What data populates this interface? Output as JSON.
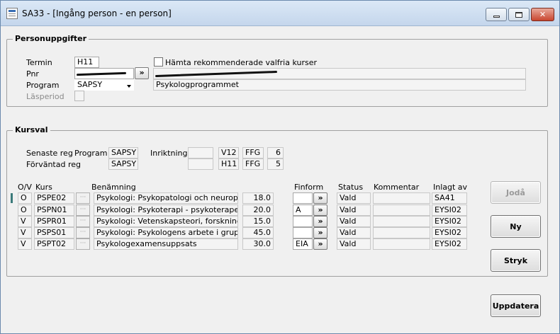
{
  "window": {
    "title": "SA33 - [Ingång person - en person]"
  },
  "personuppgifter": {
    "group_label": "Personuppgifter",
    "termin_label": "Termin",
    "termin_value": "H11",
    "pnr_label": "Pnr",
    "program_label": "Program",
    "program_value": "SAPSY",
    "program_name": "Psykologprogrammet",
    "lasperiod_label": "Läsperiod",
    "hamta_label": "Hämta rekommenderade valfria kurser",
    "lookup_glyph": "»"
  },
  "kursval": {
    "group_label": "Kursval",
    "senaste_label": "Senaste reg",
    "forvantad_label": "Förväntad reg",
    "program_col_label": "Program",
    "inriktning_label": "Inriktning",
    "senaste": {
      "program": "SAPSY",
      "inriktning": "",
      "termin": "V12",
      "ffg": "FFG",
      "count": "6"
    },
    "forvantad": {
      "program": "SAPSY",
      "inriktning": "",
      "termin": "H11",
      "ffg": "FFG",
      "count": "5"
    },
    "headers": {
      "ov": "O/V",
      "kurs": "Kurs",
      "benamning": "Benämning",
      "finform": "Finform",
      "status": "Status",
      "kommentar": "Kommentar",
      "inlagt": "Inlagt av"
    },
    "rows": [
      {
        "ov": "O",
        "kurs": "PSPE02",
        "benamning": "Psykologi: Psykopatologi och neuropsykologi",
        "hp": "18.0",
        "finform": "",
        "status": "Vald",
        "kommentar": "",
        "inlagt": "SA41"
      },
      {
        "ov": "O",
        "kurs": "PSPN01",
        "benamning": "Psykologi: Psykoterapi - psykoterapeutisk",
        "hp": "20.0",
        "finform": "A",
        "status": "Vald",
        "kommentar": "",
        "inlagt": "EYSI02"
      },
      {
        "ov": "V",
        "kurs": "PSPR01",
        "benamning": "Psykologi: Vetenskapsteori, forskningsmetodik",
        "hp": "15.0",
        "finform": "",
        "status": "Vald",
        "kommentar": "",
        "inlagt": "EYSI02"
      },
      {
        "ov": "V",
        "kurs": "PSPS01",
        "benamning": "Psykologi: Psykologens arbete i grupper och",
        "hp": "45.0",
        "finform": "",
        "status": "Vald",
        "kommentar": "",
        "inlagt": "EYSI02"
      },
      {
        "ov": "V",
        "kurs": "PSPT02",
        "benamning": "Psykologexamensuppsats",
        "hp": "30.0",
        "finform": "EIA",
        "status": "Vald",
        "kommentar": "",
        "inlagt": "EYSI02"
      }
    ],
    "dot_glyph": "···",
    "finform_glyph": "»"
  },
  "buttons": {
    "joda": "Jodå",
    "ny": "Ny",
    "stryk": "Stryk",
    "uppdatera": "Uppdatera"
  },
  "icons": {
    "app": "app-window-icon",
    "minimize": "minimize-icon",
    "maximize": "maximize-icon",
    "close": "close-icon"
  },
  "colors": {
    "titlebar": "#c4d6ec",
    "close_button": "#c8452f",
    "row_marker": "#3b7a7a"
  }
}
